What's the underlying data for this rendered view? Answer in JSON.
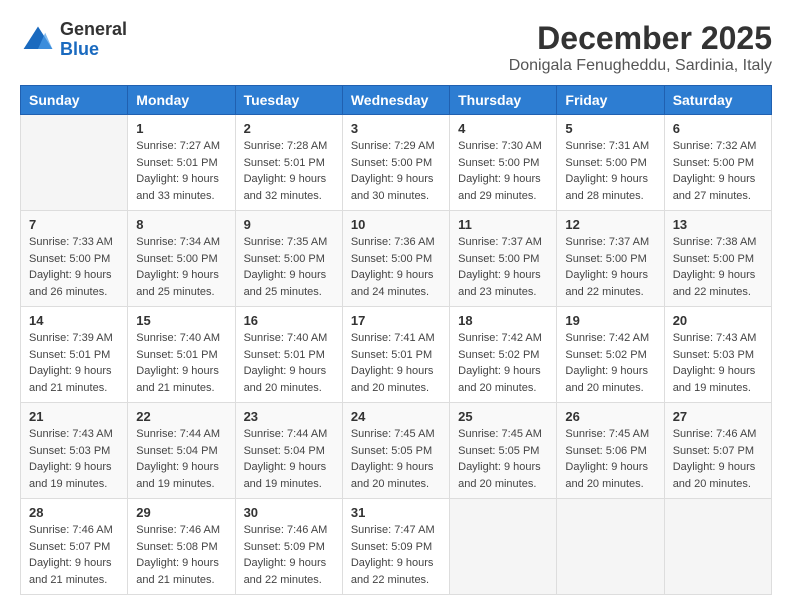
{
  "header": {
    "logo_line1": "General",
    "logo_line2": "Blue",
    "main_title": "December 2025",
    "subtitle": "Donigala Fenugheddu, Sardinia, Italy"
  },
  "calendar": {
    "headers": [
      "Sunday",
      "Monday",
      "Tuesday",
      "Wednesday",
      "Thursday",
      "Friday",
      "Saturday"
    ],
    "weeks": [
      [
        {
          "day": "",
          "info": ""
        },
        {
          "day": "1",
          "info": "Sunrise: 7:27 AM\nSunset: 5:01 PM\nDaylight: 9 hours\nand 33 minutes."
        },
        {
          "day": "2",
          "info": "Sunrise: 7:28 AM\nSunset: 5:01 PM\nDaylight: 9 hours\nand 32 minutes."
        },
        {
          "day": "3",
          "info": "Sunrise: 7:29 AM\nSunset: 5:00 PM\nDaylight: 9 hours\nand 30 minutes."
        },
        {
          "day": "4",
          "info": "Sunrise: 7:30 AM\nSunset: 5:00 PM\nDaylight: 9 hours\nand 29 minutes."
        },
        {
          "day": "5",
          "info": "Sunrise: 7:31 AM\nSunset: 5:00 PM\nDaylight: 9 hours\nand 28 minutes."
        },
        {
          "day": "6",
          "info": "Sunrise: 7:32 AM\nSunset: 5:00 PM\nDaylight: 9 hours\nand 27 minutes."
        }
      ],
      [
        {
          "day": "7",
          "info": "Sunrise: 7:33 AM\nSunset: 5:00 PM\nDaylight: 9 hours\nand 26 minutes."
        },
        {
          "day": "8",
          "info": "Sunrise: 7:34 AM\nSunset: 5:00 PM\nDaylight: 9 hours\nand 25 minutes."
        },
        {
          "day": "9",
          "info": "Sunrise: 7:35 AM\nSunset: 5:00 PM\nDaylight: 9 hours\nand 25 minutes."
        },
        {
          "day": "10",
          "info": "Sunrise: 7:36 AM\nSunset: 5:00 PM\nDaylight: 9 hours\nand 24 minutes."
        },
        {
          "day": "11",
          "info": "Sunrise: 7:37 AM\nSunset: 5:00 PM\nDaylight: 9 hours\nand 23 minutes."
        },
        {
          "day": "12",
          "info": "Sunrise: 7:37 AM\nSunset: 5:00 PM\nDaylight: 9 hours\nand 22 minutes."
        },
        {
          "day": "13",
          "info": "Sunrise: 7:38 AM\nSunset: 5:00 PM\nDaylight: 9 hours\nand 22 minutes."
        }
      ],
      [
        {
          "day": "14",
          "info": "Sunrise: 7:39 AM\nSunset: 5:01 PM\nDaylight: 9 hours\nand 21 minutes."
        },
        {
          "day": "15",
          "info": "Sunrise: 7:40 AM\nSunset: 5:01 PM\nDaylight: 9 hours\nand 21 minutes."
        },
        {
          "day": "16",
          "info": "Sunrise: 7:40 AM\nSunset: 5:01 PM\nDaylight: 9 hours\nand 20 minutes."
        },
        {
          "day": "17",
          "info": "Sunrise: 7:41 AM\nSunset: 5:01 PM\nDaylight: 9 hours\nand 20 minutes."
        },
        {
          "day": "18",
          "info": "Sunrise: 7:42 AM\nSunset: 5:02 PM\nDaylight: 9 hours\nand 20 minutes."
        },
        {
          "day": "19",
          "info": "Sunrise: 7:42 AM\nSunset: 5:02 PM\nDaylight: 9 hours\nand 20 minutes."
        },
        {
          "day": "20",
          "info": "Sunrise: 7:43 AM\nSunset: 5:03 PM\nDaylight: 9 hours\nand 19 minutes."
        }
      ],
      [
        {
          "day": "21",
          "info": "Sunrise: 7:43 AM\nSunset: 5:03 PM\nDaylight: 9 hours\nand 19 minutes."
        },
        {
          "day": "22",
          "info": "Sunrise: 7:44 AM\nSunset: 5:04 PM\nDaylight: 9 hours\nand 19 minutes."
        },
        {
          "day": "23",
          "info": "Sunrise: 7:44 AM\nSunset: 5:04 PM\nDaylight: 9 hours\nand 19 minutes."
        },
        {
          "day": "24",
          "info": "Sunrise: 7:45 AM\nSunset: 5:05 PM\nDaylight: 9 hours\nand 20 minutes."
        },
        {
          "day": "25",
          "info": "Sunrise: 7:45 AM\nSunset: 5:05 PM\nDaylight: 9 hours\nand 20 minutes."
        },
        {
          "day": "26",
          "info": "Sunrise: 7:45 AM\nSunset: 5:06 PM\nDaylight: 9 hours\nand 20 minutes."
        },
        {
          "day": "27",
          "info": "Sunrise: 7:46 AM\nSunset: 5:07 PM\nDaylight: 9 hours\nand 20 minutes."
        }
      ],
      [
        {
          "day": "28",
          "info": "Sunrise: 7:46 AM\nSunset: 5:07 PM\nDaylight: 9 hours\nand 21 minutes."
        },
        {
          "day": "29",
          "info": "Sunrise: 7:46 AM\nSunset: 5:08 PM\nDaylight: 9 hours\nand 21 minutes."
        },
        {
          "day": "30",
          "info": "Sunrise: 7:46 AM\nSunset: 5:09 PM\nDaylight: 9 hours\nand 22 minutes."
        },
        {
          "day": "31",
          "info": "Sunrise: 7:47 AM\nSunset: 5:09 PM\nDaylight: 9 hours\nand 22 minutes."
        },
        {
          "day": "",
          "info": ""
        },
        {
          "day": "",
          "info": ""
        },
        {
          "day": "",
          "info": ""
        }
      ]
    ]
  }
}
